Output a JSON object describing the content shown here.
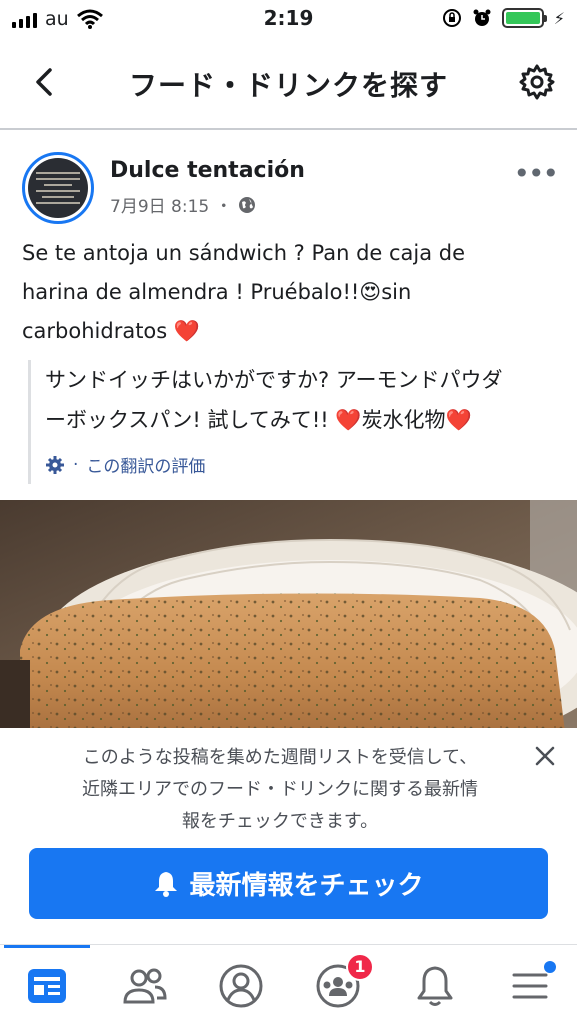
{
  "status_bar": {
    "carrier": "au",
    "time": "2:19"
  },
  "nav": {
    "title": "フード・ドリンクを探す"
  },
  "post": {
    "author": "Dulce tentación",
    "date": "7月9日 8:15",
    "separator": "・",
    "text_line1": "Se te antoja un sándwich ? Pan de caja de",
    "text_line2_a": "harina de almendra ! Pruébalo!!",
    "text_line2_emoji": "😍",
    "text_line2_b": "sin",
    "text_line3": "carbohidratos ",
    "heart": "❤️",
    "translation_line1": "サンドイッチはいかがですか? アーモンドパウダ",
    "translation_line2_a": "ーボックスパン! 試してみて!! ",
    "translation_line2_b": "炭水化物",
    "rate_separator": "·",
    "rate_label": "この翻訳の評価"
  },
  "notice": {
    "line1": "このような投稿を集めた週間リストを受信して、",
    "line2": "近隣エリアでのフード・ドリンクに関する最新情",
    "line3": "報をチェックできます。",
    "cta_label": "最新情報をチェック"
  },
  "tabs": {
    "groups_badge": "1"
  },
  "colors": {
    "accent": "#1877f2",
    "badge": "#f02849",
    "battery": "#34c759"
  },
  "icons": [
    "wifi-icon",
    "lock-rotation-icon",
    "alarm-icon",
    "battery-icon",
    "back-icon",
    "gear-icon",
    "globe-icon",
    "more-icon",
    "close-icon",
    "bell-icon",
    "news-feed-icon",
    "friends-icon",
    "profile-icon",
    "groups-icon",
    "notifications-icon",
    "menu-icon"
  ]
}
